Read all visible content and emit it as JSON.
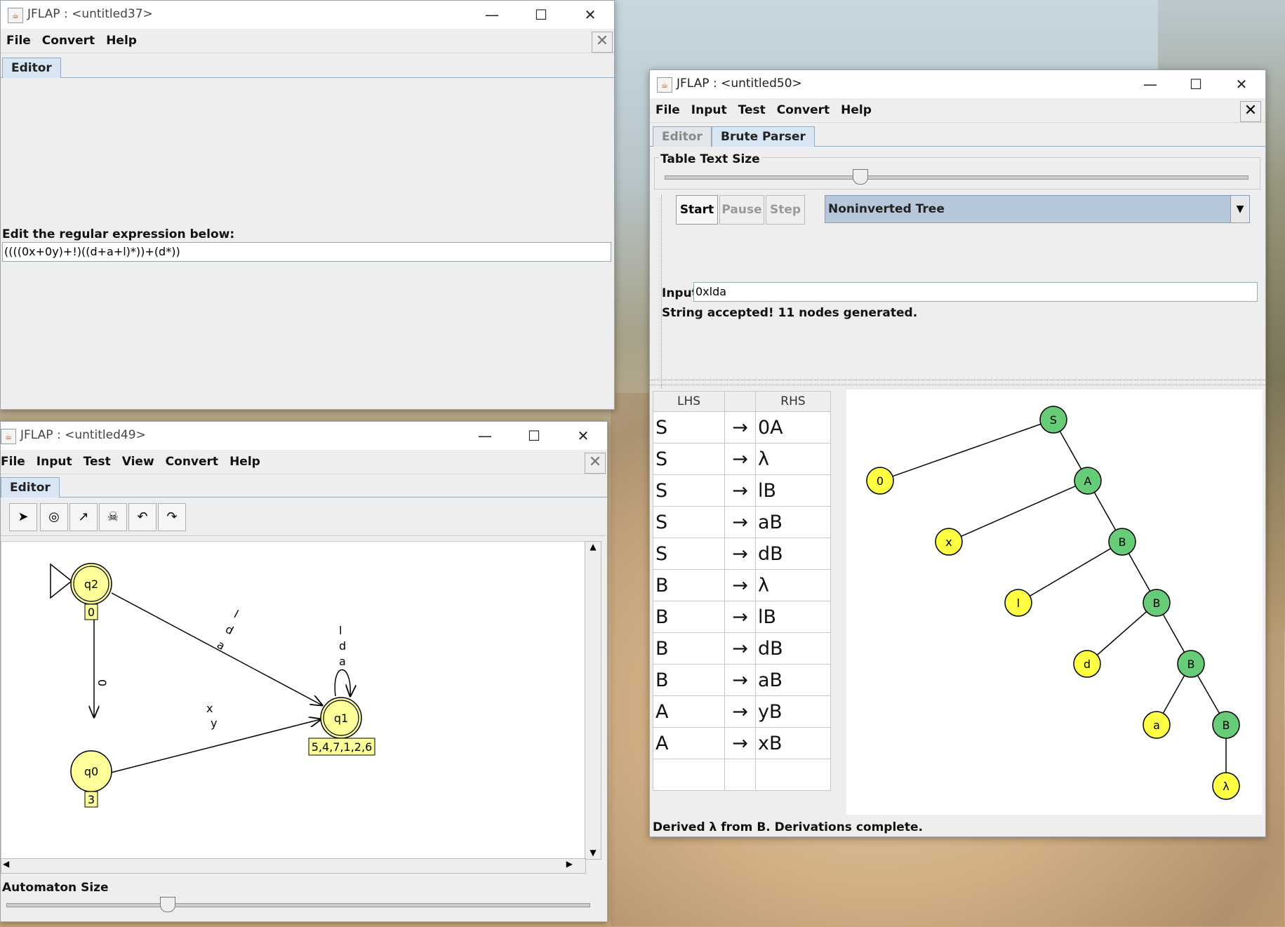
{
  "win37": {
    "title": "JFLAP : <untitled37>",
    "menu": [
      "File",
      "Convert",
      "Help"
    ],
    "tab": "Editor",
    "prompt": "Edit the regular expression below:",
    "regex": "((((0x+0y)+!)((d+a+l)*))+(d*))"
  },
  "win49": {
    "title": "JFLAP : <untitled49>",
    "menu": [
      "File",
      "Input",
      "Test",
      "View",
      "Convert",
      "Help"
    ],
    "tab": "Editor",
    "tools": [
      "pointer-tool",
      "state-tool",
      "transition-tool",
      "delete-tool",
      "undo-tool",
      "redo-tool"
    ],
    "states": {
      "q2": {
        "label": "q2",
        "tag": "0"
      },
      "q1": {
        "label": "q1",
        "tag": "5,4,7,1,2,6"
      },
      "q0": {
        "label": "q0",
        "tag": "3"
      }
    },
    "transitions": {
      "q2_q1": [
        "l",
        "d",
        "a"
      ],
      "q1_q1": [
        "l",
        "d",
        "a"
      ],
      "q2_q0": [
        "0"
      ],
      "q0_q1": [
        "x",
        "y"
      ]
    },
    "size_label": "Automaton Size"
  },
  "win50": {
    "title": "JFLAP : <untitled50>",
    "menu": [
      "File",
      "Input",
      "Test",
      "Convert",
      "Help"
    ],
    "tabs": [
      "Editor",
      "Brute Parser"
    ],
    "text_size_label": "Table Text Size",
    "buttons": {
      "start": "Start",
      "pause": "Pause",
      "step": "Step"
    },
    "view_mode": "Noninverted Tree",
    "input_label": "Input",
    "input_value": "0xlda",
    "status": "String accepted!  11 nodes generated.",
    "grammar_headers": {
      "lhs": "LHS",
      "rhs": "RHS"
    },
    "arrow": "→",
    "productions": [
      {
        "lhs": "S",
        "rhs": "0A"
      },
      {
        "lhs": "S",
        "rhs": "λ"
      },
      {
        "lhs": "S",
        "rhs": "lB"
      },
      {
        "lhs": "S",
        "rhs": "aB"
      },
      {
        "lhs": "S",
        "rhs": "dB"
      },
      {
        "lhs": "B",
        "rhs": "λ"
      },
      {
        "lhs": "B",
        "rhs": "lB"
      },
      {
        "lhs": "B",
        "rhs": "dB"
      },
      {
        "lhs": "B",
        "rhs": "aB"
      },
      {
        "lhs": "A",
        "rhs": "yB"
      },
      {
        "lhs": "A",
        "rhs": "xB"
      }
    ],
    "tree_nodes": [
      "S",
      "0",
      "A",
      "x",
      "B",
      "l",
      "B",
      "d",
      "B",
      "a",
      "B",
      "λ"
    ],
    "footer": "Derived λ from B.  Derivations complete."
  },
  "colors": {
    "state_fill": "#ffff99",
    "nonterminal": "#66cc77",
    "terminal": "#ffff44",
    "tab_selected": "#d8e6f4"
  }
}
